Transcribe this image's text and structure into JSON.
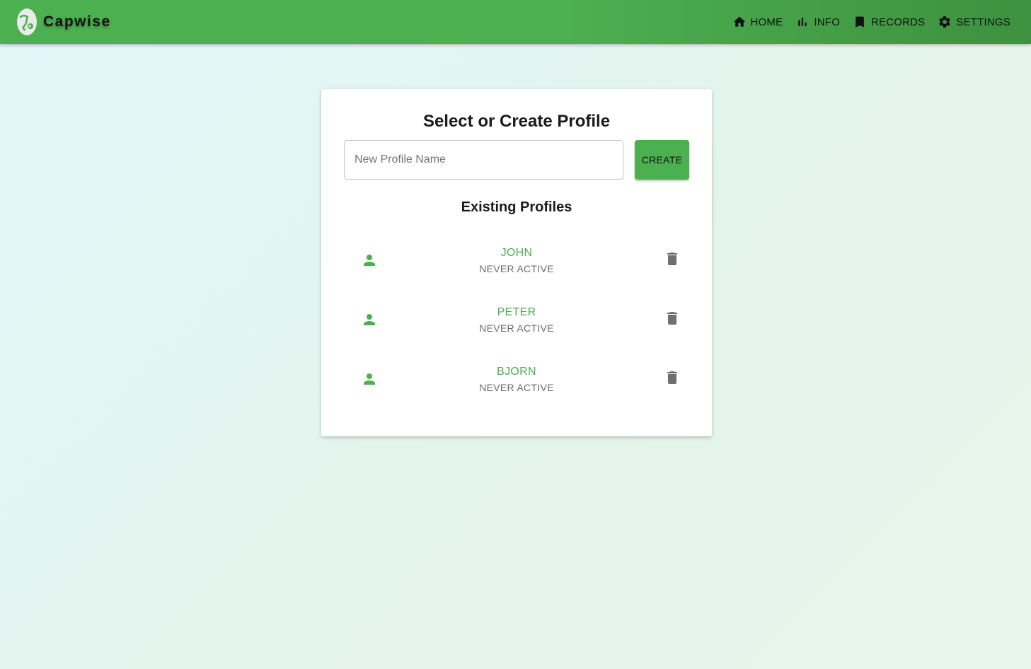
{
  "app": {
    "name": "Capwise",
    "accent_color": "#4caf50"
  },
  "nav": {
    "items": [
      {
        "label": "HOME",
        "icon": "home-icon"
      },
      {
        "label": "INFO",
        "icon": "bar-chart-icon"
      },
      {
        "label": "RECORDS",
        "icon": "bookmark-icon"
      },
      {
        "label": "SETTINGS",
        "icon": "gear-icon"
      }
    ]
  },
  "profile_card": {
    "title": "Select or Create Profile",
    "input": {
      "placeholder": "New Profile Name",
      "value": ""
    },
    "create_label": "CREATE",
    "existing_title": "Existing Profiles",
    "profiles": [
      {
        "name": "JOHN",
        "status": "NEVER ACTIVE"
      },
      {
        "name": "PETER",
        "status": "NEVER ACTIVE"
      },
      {
        "name": "BJORN",
        "status": "NEVER ACTIVE"
      }
    ]
  }
}
